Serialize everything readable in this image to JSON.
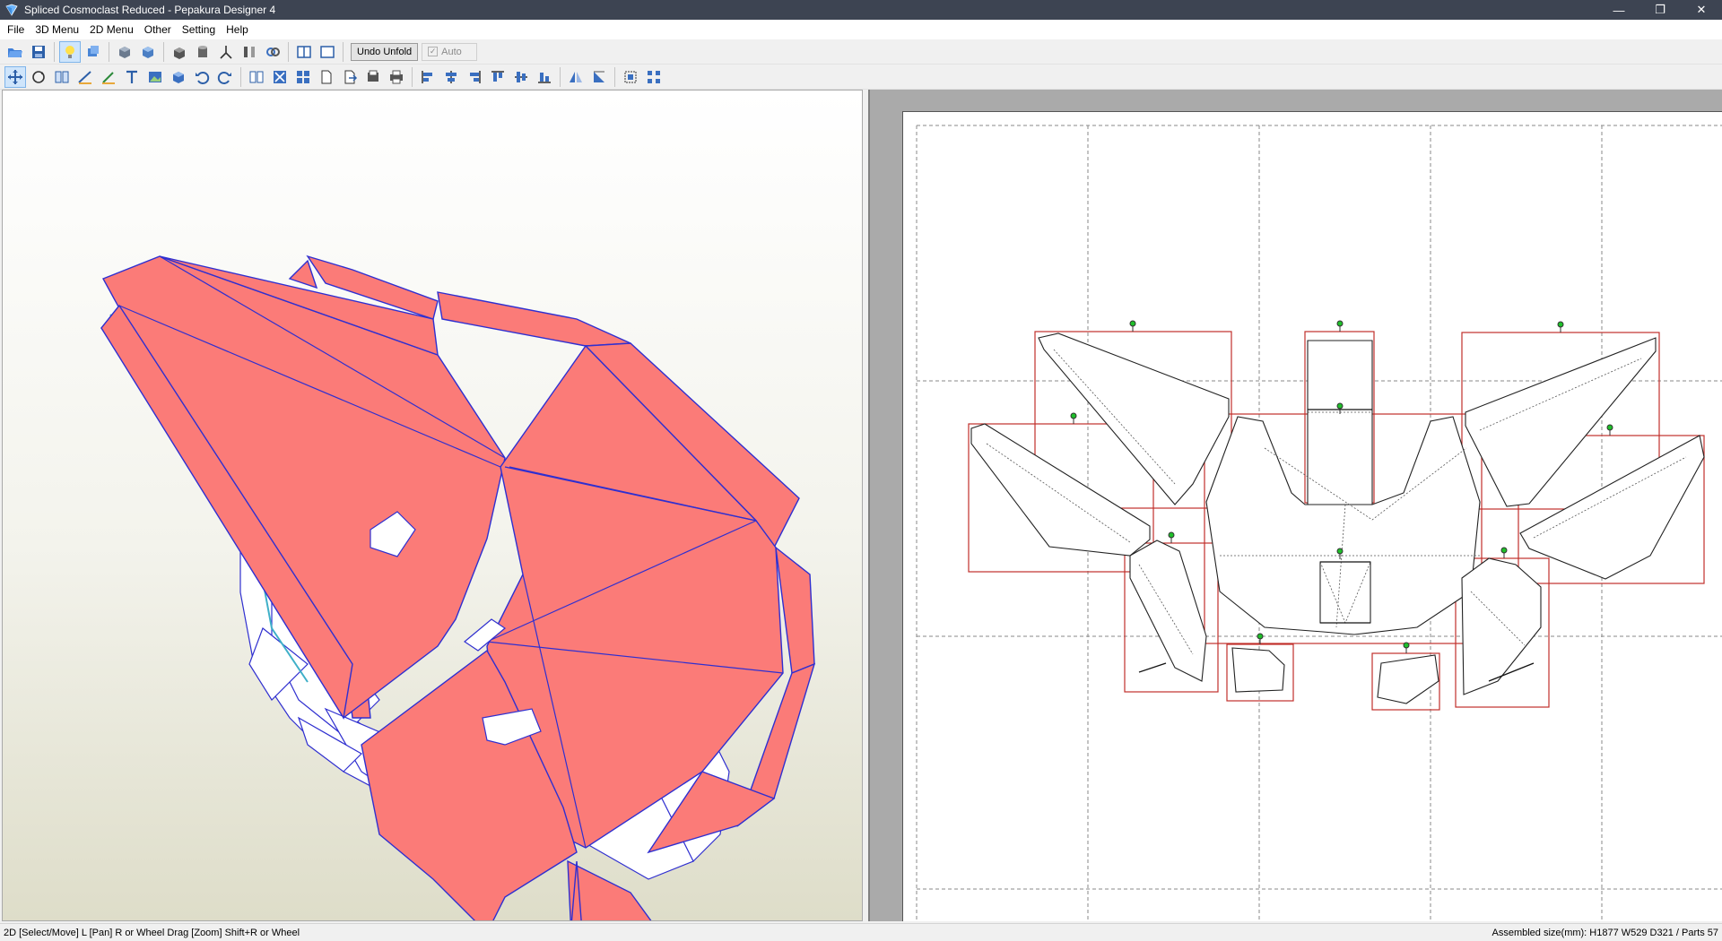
{
  "window": {
    "title": "Spliced Cosmoclast Reduced - Pepakura Designer 4",
    "controls": {
      "minimize": "—",
      "restore": "❐",
      "close": "✕"
    }
  },
  "menu": [
    "File",
    "3D Menu",
    "2D Menu",
    "Other",
    "Setting",
    "Help"
  ],
  "toolbar1": {
    "icons": [
      "open-icon",
      "save-icon",
      "light-icon",
      "rotate-3d-icon",
      "cube-move-icon",
      "cube-rotate-icon",
      "texture-icon",
      "cylinder-icon",
      "axis-icon",
      "flip-icon",
      "link-icon",
      "split-view-icon",
      "single-view-icon"
    ],
    "undo_unfold_label": "Undo Unfold",
    "auto_label": "Auto",
    "auto_checked": true
  },
  "toolbar2": {
    "icons": [
      "select-icon",
      "rotate-part-icon",
      "join-icon",
      "edge-icon",
      "flap-icon",
      "text-icon",
      "image-icon",
      "3d-part-icon",
      "undo-icon",
      "redo-icon",
      "book-icon",
      "cut-icon",
      "grid-icon",
      "page-icon",
      "page-export-icon",
      "page-print-icon",
      "print-icon",
      "align-left-icon",
      "align-center-icon",
      "align-right-icon",
      "align-top-icon",
      "align-middle-icon",
      "align-bottom-icon",
      "mirror-h-icon",
      "mirror-v-icon",
      "fit-page-icon",
      "distribute-icon"
    ]
  },
  "status": {
    "left": "2D [Select/Move] L [Pan] R or Wheel Drag [Zoom] Shift+R or Wheel",
    "right": "Assembled size(mm): H1877 W529 D321 / Parts 57"
  },
  "colors": {
    "titlebar": "#3d4452",
    "part_fill": "#fb7b78",
    "part_edge": "#2f2fd0",
    "bounding_box": "#c0302b",
    "flap_pin": "#1fbf2a"
  }
}
